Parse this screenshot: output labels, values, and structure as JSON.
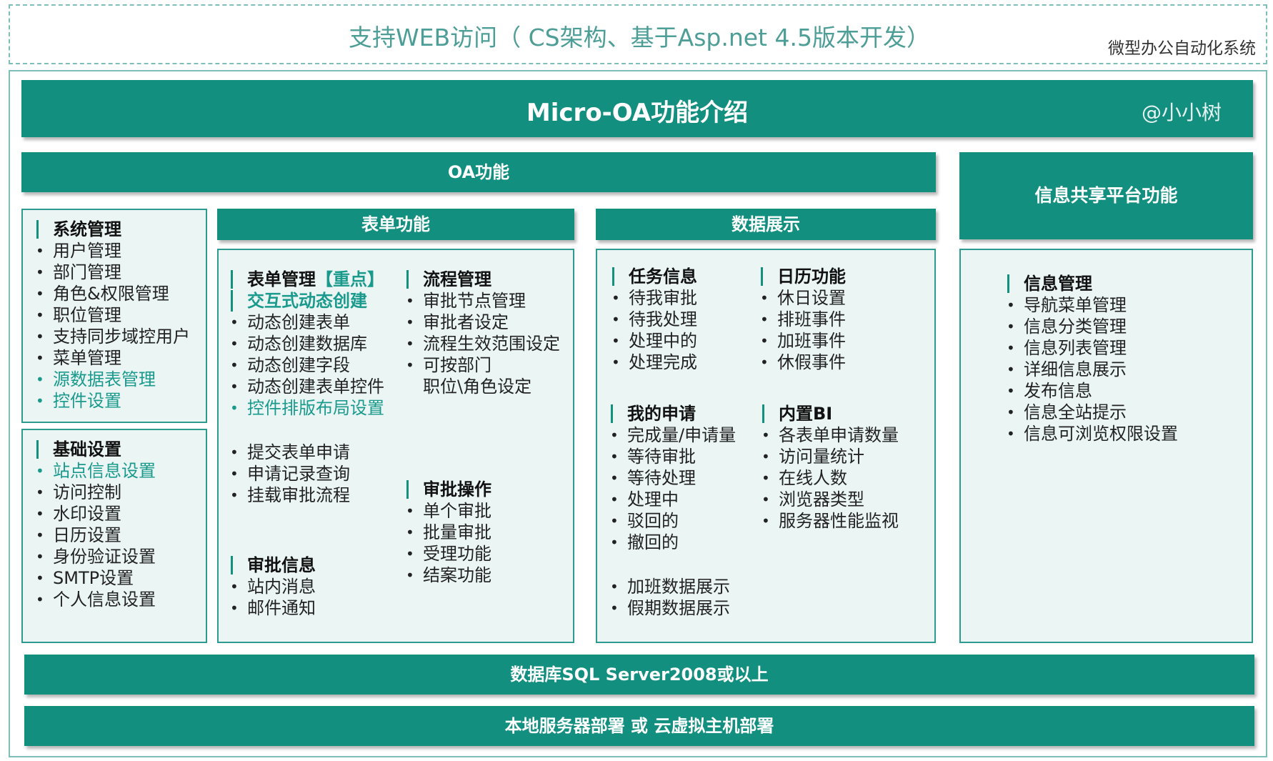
{
  "banner": {
    "title": "支持WEB访问（ CS架构、基于Asp.net  4.5版本开发）",
    "subtitle": "微型办公自动化系统"
  },
  "header": {
    "title": "Micro-OA功能介绍",
    "author": "@小小树"
  },
  "oa_bar": "OA功能",
  "share_bar": "信息共享平台功能",
  "form_bar": "表单功能",
  "data_bar": "数据展示",
  "db_bar": "数据库SQL Server2008或以上",
  "deploy_bar": "本地服务器部署 或 云虚拟主机部署",
  "system": {
    "title": "系统管理",
    "items": [
      "用户管理",
      "部门管理",
      "角色&权限管理",
      "职位管理",
      "支持同步域控用户",
      "菜单管理",
      "源数据表管理",
      "控件设置"
    ]
  },
  "base": {
    "title": "基础设置",
    "items": [
      "站点信息设置",
      "访问控制",
      "水印设置",
      "日历设置",
      "身份验证设置",
      "SMTP设置",
      "个人信息设置"
    ]
  },
  "form_mgmt": {
    "title": "表单管理",
    "title_highlight": "【重点】",
    "subtitle": "交互式动态创建",
    "items": [
      "动态创建表单",
      "动态创建数据库",
      "动态创建字段",
      "动态创建表单控件",
      "控件排版布局设置"
    ],
    "items2": [
      "提交表单申请",
      "申请记录查询",
      "挂载审批流程"
    ]
  },
  "flow_mgmt": {
    "title": "流程管理",
    "items": [
      "审批节点管理",
      "审批者设定",
      "流程生效范围设定",
      "可按部门"
    ],
    "continuation": "职位\\角色设定"
  },
  "approve_ops": {
    "title": "审批操作",
    "items": [
      "单个审批",
      "批量审批",
      "受理功能",
      "结案功能"
    ]
  },
  "approve_info": {
    "title": "审批信息",
    "items": [
      "站内消息",
      "邮件通知"
    ]
  },
  "task_info": {
    "title": "任务信息",
    "items": [
      "待我审批",
      "待我处理",
      "处理中的",
      "处理完成"
    ]
  },
  "calendar": {
    "title": "日历功能",
    "items": [
      "休日设置",
      "排班事件",
      "加班事件",
      "休假事件"
    ]
  },
  "my_apply": {
    "title": "我的申请",
    "items": [
      "完成量/申请量",
      "等待审批",
      "等待处理",
      "处理中",
      "驳回的",
      "撤回的"
    ],
    "items2": [
      "加班数据展示",
      "假期数据展示"
    ]
  },
  "bi": {
    "title": "内置BI",
    "items": [
      "各表单申请数量",
      "访问量统计",
      "在线人数",
      "浏览器类型",
      "服务器性能监视"
    ]
  },
  "info_mgmt": {
    "title": "信息管理",
    "items": [
      "导航菜单管理",
      "信息分类管理",
      "信息列表管理",
      "详细信息展示",
      "发布信息",
      "信息全站提示",
      "信息可浏览权限设置"
    ]
  }
}
